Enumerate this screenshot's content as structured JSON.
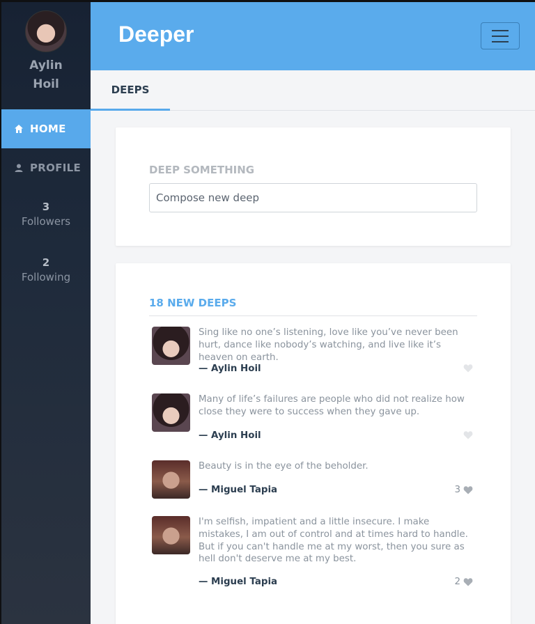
{
  "user": {
    "name": "Aylin Hoil"
  },
  "nav": {
    "home_label": "HOME",
    "profile_label": "PROFILE"
  },
  "stats": {
    "followers": {
      "count": "3",
      "label": "Followers"
    },
    "following": {
      "count": "2",
      "label": "Following"
    }
  },
  "header": {
    "brand": "Deeper"
  },
  "tabs": [
    {
      "label": "DEEPS"
    }
  ],
  "compose": {
    "label": "DEEP SOMETHING",
    "placeholder": "Compose new deep"
  },
  "feed": {
    "title": "18 NEW DEEPS",
    "deeps": [
      {
        "text": "Sing like no one’s listening, love like you’ve never been hurt, dance like nobody’s watching, and live like it’s heaven on earth.",
        "author": "— Aylin Hoil",
        "likes": ""
      },
      {
        "text": "Many of life’s failures are people who did not realize how close they were to success when they gave up.",
        "author": "— Aylin Hoil",
        "likes": ""
      },
      {
        "text": "Beauty is in the eye of the beholder.",
        "author": "— Miguel Tapia",
        "likes": "3"
      },
      {
        "text": "I'm selfish, impatient and a little insecure. I make mistakes, I am out of control and at times hard to handle. But if you can't handle me at my worst, then you sure as hell don't deserve me at my best.",
        "author": "— Miguel Tapia",
        "likes": "2"
      }
    ]
  },
  "colors": {
    "accent": "#5aabec",
    "sidebar": "#1e2a3b",
    "dark_text": "#2c3e50"
  }
}
